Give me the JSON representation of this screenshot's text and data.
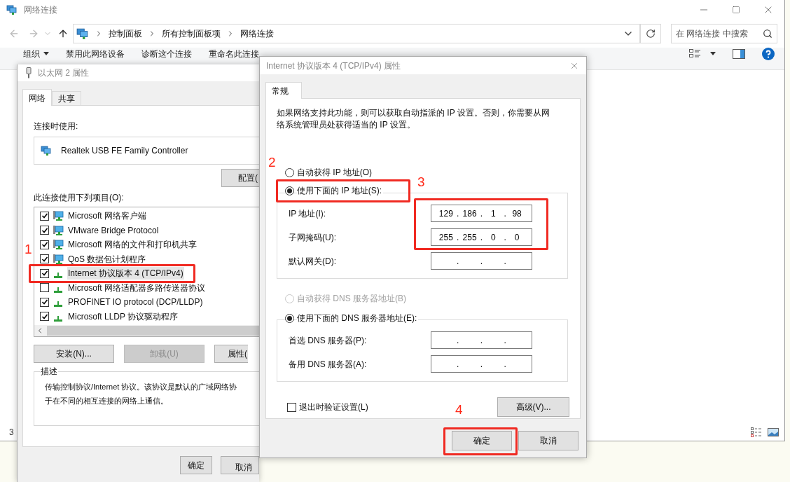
{
  "explorer": {
    "title": "网络连接",
    "breadcrumbs": [
      "控制面板",
      "所有控制面板项",
      "网络连接"
    ],
    "search": {
      "placeholder": "在 网络连接 中搜索"
    },
    "toolbar": [
      {
        "label": "组织",
        "menu": true
      },
      {
        "label": "禁用此网络设备",
        "menu": false
      },
      {
        "label": "诊断这个连接",
        "menu": false
      },
      {
        "label": "重命名此连接",
        "menu": false
      }
    ],
    "status_bar": "3"
  },
  "left_dialog": {
    "title": "以太网 2 属性",
    "tabs": [
      {
        "label": "网络",
        "selected": true
      },
      {
        "label": "共享",
        "selected": false
      }
    ],
    "connect_using_label": "连接时使用:",
    "adapter": "Realtek USB FE Family Controller",
    "configure_button": "配置(",
    "items_label": "此连接使用下列项目(O):",
    "items": [
      {
        "label": "Microsoft 网络客户端",
        "checked": true,
        "selected": false,
        "kind": "service"
      },
      {
        "label": "VMware Bridge Protocol",
        "checked": true,
        "selected": false,
        "kind": "service"
      },
      {
        "label": "Microsoft 网络的文件和打印机共享",
        "checked": true,
        "selected": false,
        "kind": "service"
      },
      {
        "label": "QoS 数据包计划程序",
        "checked": true,
        "selected": false,
        "kind": "service"
      },
      {
        "label": "Internet 协议版本 4 (TCP/IPv4)",
        "checked": true,
        "selected": true,
        "kind": "protocol"
      },
      {
        "label": "Microsoft 网络适配器多路传送器协议",
        "checked": false,
        "selected": false,
        "kind": "protocol"
      },
      {
        "label": "PROFINET IO protocol (DCP/LLDP)",
        "checked": true,
        "selected": false,
        "kind": "protocol"
      },
      {
        "label": "Microsoft LLDP 协议驱动程序",
        "checked": true,
        "selected": false,
        "kind": "protocol"
      }
    ],
    "buttons": [
      {
        "label": "安装(N)...",
        "disabled": false
      },
      {
        "label": "卸载(U)",
        "disabled": true
      },
      {
        "label": "属性(",
        "disabled": false
      }
    ],
    "description": {
      "title": "描述",
      "lines": [
        "传输控制协议/Internet 协议。该协议是默认的广域网络协",
        "于在不同的相互连接的网络上通信。"
      ]
    },
    "footer_buttons": [
      "确定",
      "取消"
    ]
  },
  "right_dialog": {
    "title": "Internet 协议版本 4 (TCP/IPv4) 属性",
    "tabs": [
      {
        "label": "常规",
        "selected": true
      }
    ],
    "intro": "如果网络支持此功能，则可以获取自动指派的 IP 设置。否则，你需要从网络系统管理员处获得适当的 IP 设置。",
    "ip_options": [
      {
        "label": "自动获得 IP 地址(O)",
        "selected": false,
        "disabled": false
      },
      {
        "label": "使用下面的 IP 地址(S):",
        "selected": true,
        "disabled": false
      }
    ],
    "ip_fields": [
      {
        "label": "IP 地址(I):",
        "parts": [
          "129",
          ".",
          "186",
          ".",
          "1",
          ".",
          "98"
        ]
      },
      {
        "label": "子网掩码(U):",
        "parts": [
          "255",
          ".",
          "255",
          ".",
          "0",
          ".",
          "0"
        ]
      },
      {
        "label": "默认网关(D):",
        "parts": [
          ".",
          ".",
          "."
        ]
      }
    ],
    "dns_options": [
      {
        "label": "自动获得 DNS 服务器地址(B)",
        "selected": false,
        "disabled": true
      },
      {
        "label": "使用下面的 DNS 服务器地址(E):",
        "selected": true,
        "disabled": false
      }
    ],
    "dns_fields": [
      {
        "label": "首选 DNS 服务器(P):",
        "parts": [
          ".",
          ".",
          "."
        ]
      },
      {
        "label": "备用 DNS 服务器(A):",
        "parts": [
          ".",
          ".",
          "."
        ]
      }
    ],
    "validate": {
      "label": "退出时验证设置(L)",
      "checked": false
    },
    "advanced_button": "高级(V)...",
    "footer_buttons": [
      "确定",
      "取消"
    ]
  },
  "annotations": [
    {
      "label": "1"
    },
    {
      "label": "2"
    },
    {
      "label": "3"
    },
    {
      "label": "4"
    }
  ]
}
